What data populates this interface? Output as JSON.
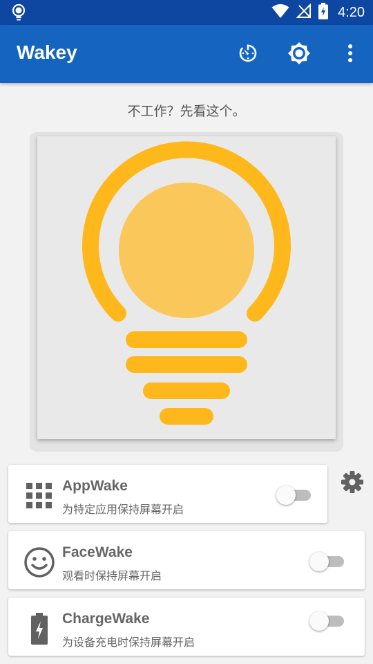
{
  "status_bar": {
    "time": "4:20",
    "icons": [
      "bulb-icon",
      "wifi-icon",
      "signal-off-icon",
      "battery-charging-icon"
    ]
  },
  "app_bar": {
    "title": "Wakey",
    "actions": [
      "timer-icon",
      "brightness-settings-icon",
      "more-vert-icon"
    ]
  },
  "hint_text": "不工作？先看这个。",
  "preview": {
    "icon": "lightbulb-icon",
    "colors": {
      "bulb_outline": "#ffb81c",
      "bulb_center": "#f9c75a",
      "background": "#e9e9e9"
    }
  },
  "cards": [
    {
      "id": "appwake",
      "icon": "apps-grid-icon",
      "title": "AppWake",
      "subtitle": "为特定应用保持屏幕开启",
      "enabled": false,
      "has_settings": true
    },
    {
      "id": "facewake",
      "icon": "face-icon",
      "title": "FaceWake",
      "subtitle": "观看时保持屏幕开启",
      "enabled": false
    },
    {
      "id": "chargewake",
      "icon": "battery-charging-icon",
      "title": "ChargeWake",
      "subtitle": "为设备充电时保持屏幕开启",
      "enabled": false
    }
  ],
  "colors": {
    "primary": "#1565c0",
    "primary_dark": "#0d47a1",
    "text_secondary": "#666666"
  }
}
